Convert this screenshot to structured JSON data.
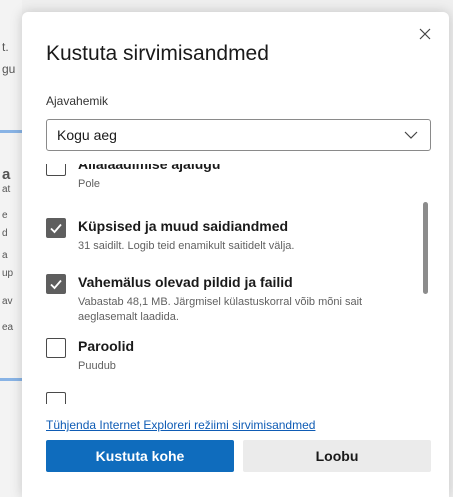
{
  "background": {
    "fragments": [
      "t.",
      "gu",
      "a",
      "at",
      "e",
      "d",
      "a",
      "up",
      "av",
      "ea"
    ]
  },
  "dialog": {
    "title": "Kustuta sirvimisandmed",
    "close_icon": "close-icon",
    "time_range": {
      "label": "Ajavahemik",
      "selected": "Kogu aeg"
    },
    "options": [
      {
        "label": "Allalaadimise ajalugu",
        "desc": "Pole",
        "checked": false
      },
      {
        "label": "Küpsised ja muud saidiandmed",
        "desc": "31 saidilt. Logib teid enamikult saitidelt välja.",
        "checked": true
      },
      {
        "label": "Vahemälus olevad pildid ja failid",
        "desc": "Vabastab 48,1 MB. Järgmisel külastuskorral võib mõni sait aeglasemalt laadida.",
        "checked": true
      },
      {
        "label": "Paroolid",
        "desc": "Puudub",
        "checked": false
      }
    ],
    "ie_link": "Tühjenda Internet Exploreri režiimi sirvimisandmed",
    "primary_button": "Kustuta kohe",
    "secondary_button": "Loobu"
  },
  "colors": {
    "accent": "#0f6cbd",
    "link": "#0f5cb5",
    "checked": "#5e5e5e"
  }
}
